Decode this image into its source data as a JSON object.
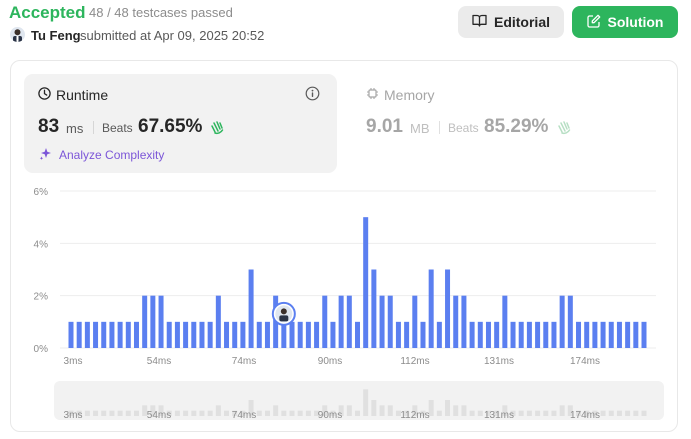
{
  "header": {
    "status": "Accepted",
    "testcases": "48 / 48 testcases passed",
    "user": "Tu Feng",
    "submitted": "submitted at Apr 09, 2025 20:52",
    "editorial_label": "Editorial",
    "solution_label": "Solution"
  },
  "runtime": {
    "title": "Runtime",
    "value": "83",
    "unit": "ms",
    "beats_label": "Beats",
    "beats_pct": "67.65%",
    "analyze_label": "Analyze Complexity"
  },
  "memory": {
    "title": "Memory",
    "value": "9.01",
    "unit": "MB",
    "beats_label": "Beats",
    "beats_pct": "85.29%"
  },
  "colors": {
    "accepted": "#2db55d",
    "bar": "#5b7ff0",
    "analyze": "#7c56d8"
  },
  "icons": [
    "book-icon",
    "edit-icon",
    "clock-icon",
    "info-icon",
    "chip-icon",
    "clap-icon",
    "sparkle-icon",
    "avatar"
  ],
  "chart_data": {
    "type": "bar",
    "ylabel": "",
    "xlabel": "",
    "y_ticks": [
      "6%",
      "4%",
      "2%",
      "0%"
    ],
    "ylim": [
      0,
      6
    ],
    "x_ticks": [
      "3ms",
      "54ms",
      "74ms",
      "90ms",
      "112ms",
      "131ms",
      "174ms"
    ],
    "values": [
      1,
      1,
      1,
      1,
      1,
      1,
      1,
      1,
      1,
      2,
      2,
      2,
      1,
      1,
      1,
      1,
      1,
      1,
      2,
      1,
      1,
      1,
      3,
      1,
      1,
      2,
      1,
      1,
      1,
      1,
      1,
      2,
      1,
      2,
      2,
      1,
      5,
      3,
      2,
      2,
      1,
      1,
      2,
      1,
      3,
      1,
      3,
      2,
      2,
      1,
      1,
      1,
      1,
      2,
      1,
      1,
      1,
      1,
      1,
      1,
      2,
      2,
      1,
      1,
      1,
      1,
      1,
      1,
      1,
      1,
      1
    ],
    "highlight_index": 26
  }
}
